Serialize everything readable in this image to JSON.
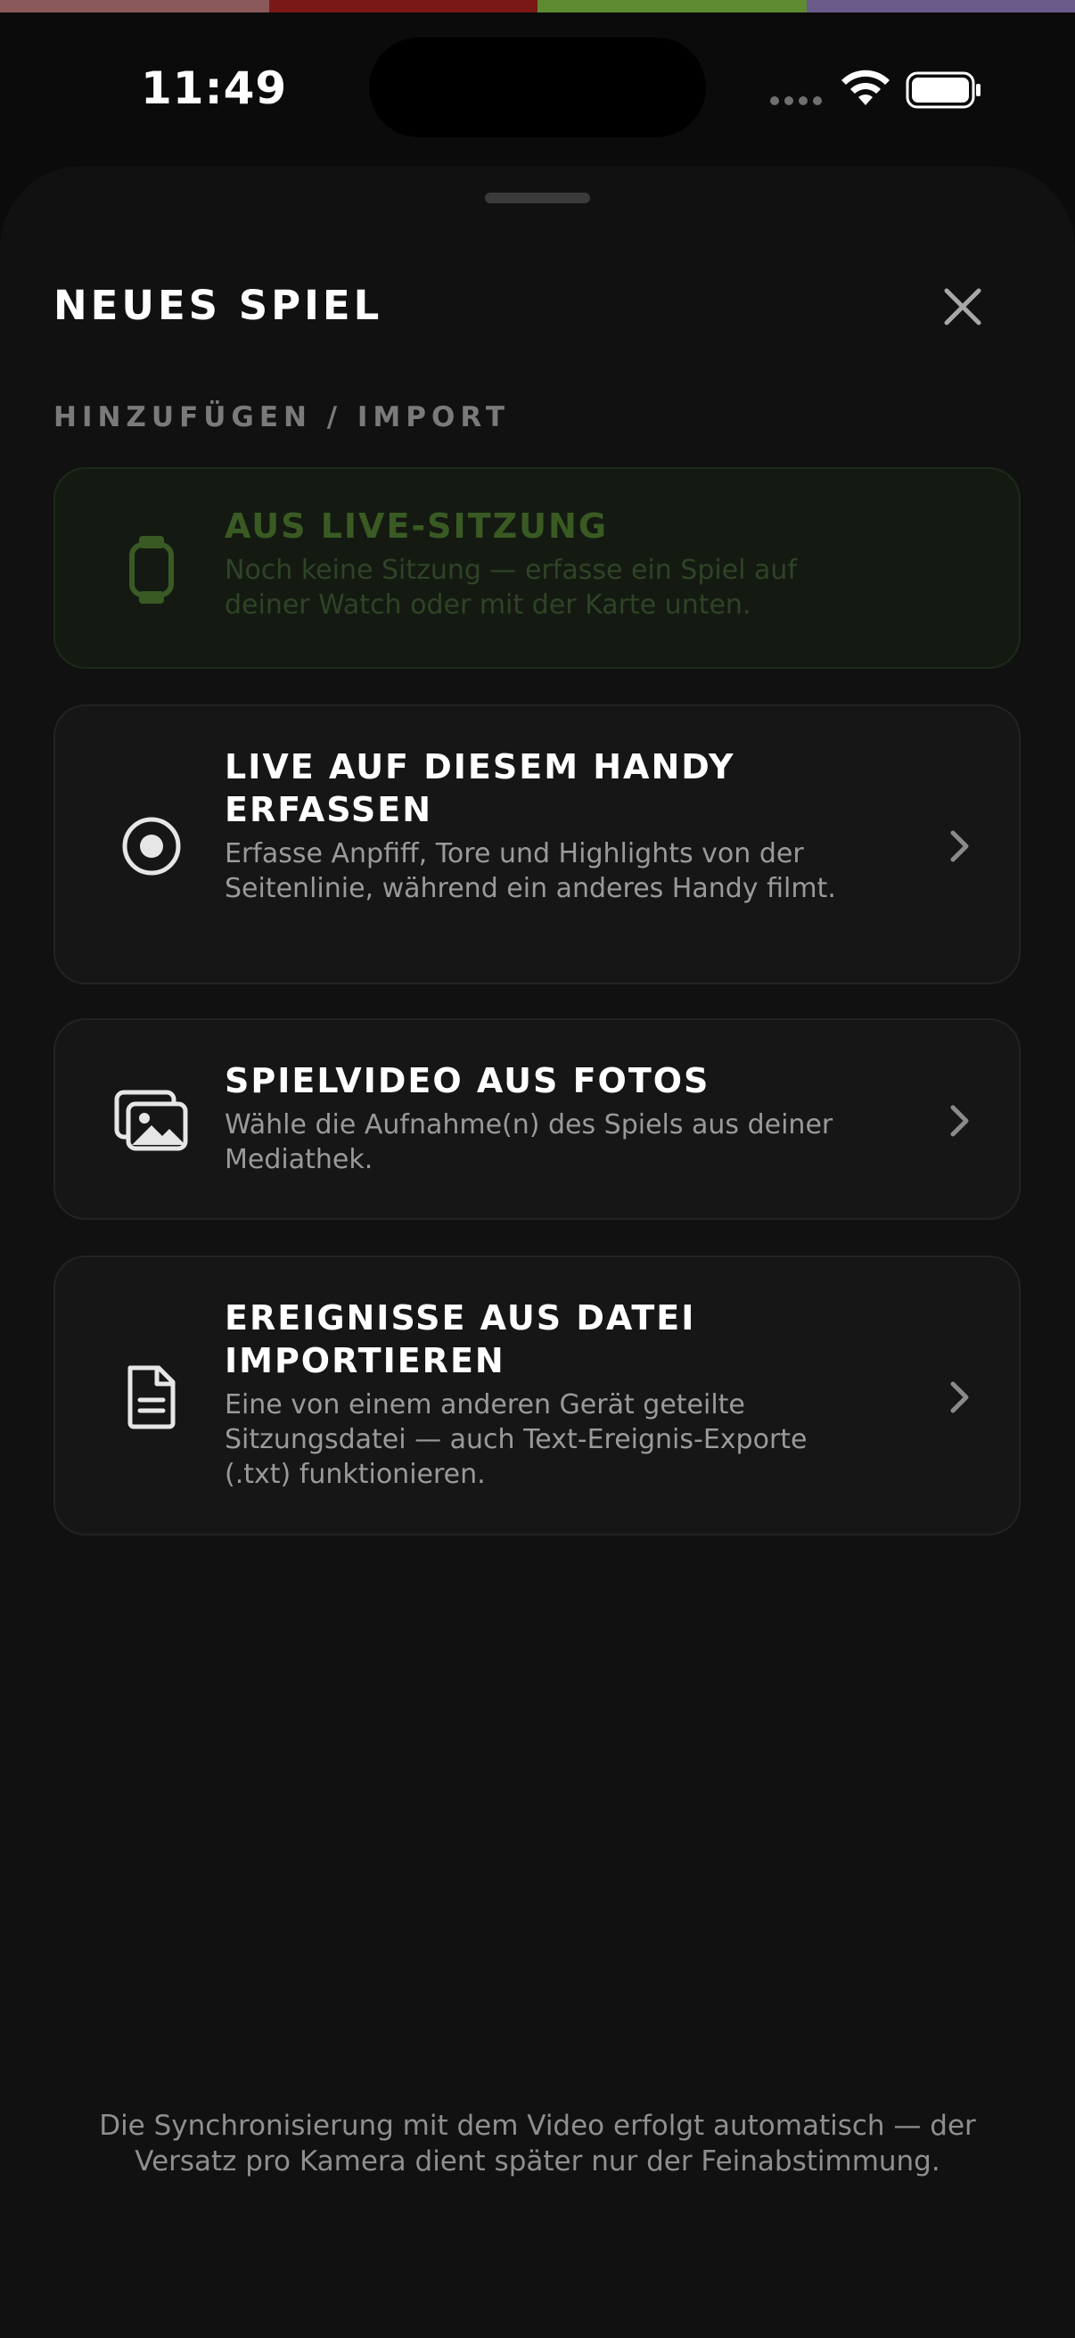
{
  "colors": {
    "strip": [
      "#8a5a5a",
      "#7a1818",
      "#5e8a32",
      "#6a5a8a"
    ],
    "accent_green": "#3a5a23"
  },
  "status_bar": {
    "time": "11:49"
  },
  "sheet": {
    "title": "NEUES SPIEL",
    "section_label": "HINZUFÜGEN / IMPORT",
    "options": [
      {
        "icon": "watch-icon",
        "title": "AUS LIVE-SITZUNG",
        "description": "Noch keine Sitzung — erfasse ein Spiel auf deiner Watch oder mit der Karte unten.",
        "enabled": false
      },
      {
        "icon": "record-icon",
        "title": "LIVE AUF DIESEM HANDY ERFASSEN",
        "description": "Erfasse Anpfiff, Tore und Highlights von der Seitenlinie, während ein anderes Handy filmt.",
        "enabled": true
      },
      {
        "icon": "photos-icon",
        "title": "SPIELVIDEO AUS FOTOS",
        "description": "Wähle die Aufnahme(n) des Spiels aus deiner Mediathek.",
        "enabled": true
      },
      {
        "icon": "document-icon",
        "title": "EREIGNISSE AUS DATEI IMPORTIEREN",
        "description": "Eine von einem anderen Gerät geteilte Sitzungsdatei — auch Text-Ereignis-Exporte (.txt) funktionieren.",
        "enabled": true
      }
    ],
    "footer_note": "Die Synchronisierung mit dem Video erfolgt automatisch — der Versatz pro Kamera dient später nur der Feinabstimmung."
  }
}
